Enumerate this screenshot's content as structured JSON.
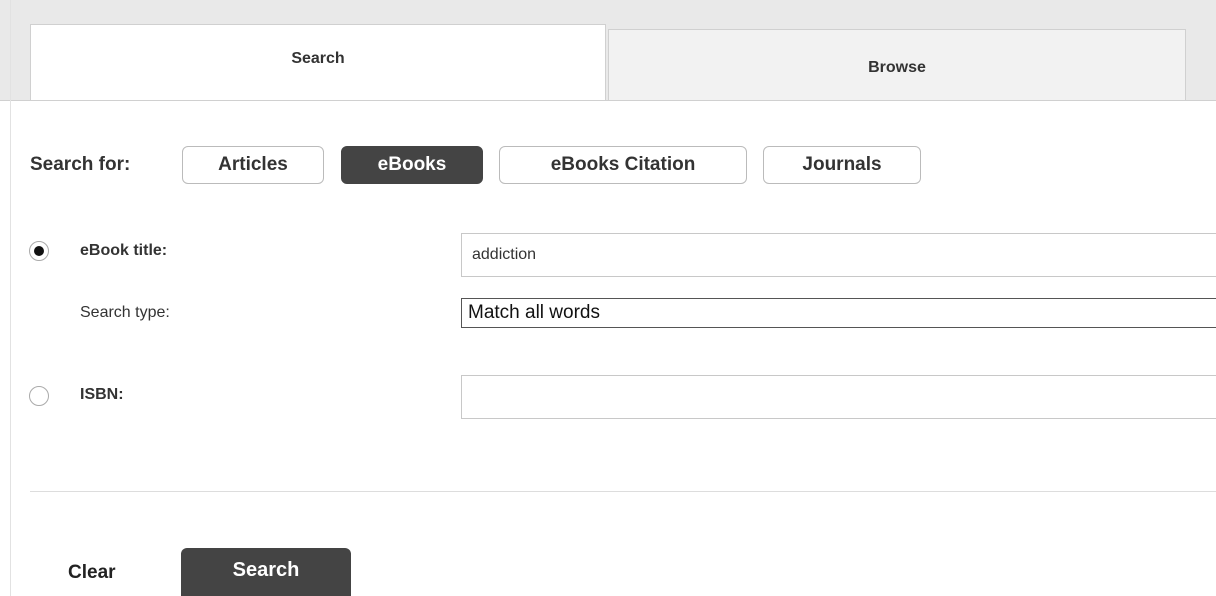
{
  "tabs": {
    "search_label": "Search",
    "browse_label": "Browse"
  },
  "search_for": {
    "label": "Search for:",
    "options": [
      "Articles",
      "eBooks",
      "eBooks Citation",
      "Journals"
    ],
    "selected": "eBooks"
  },
  "form": {
    "ebook_title_label": "eBook title:",
    "ebook_title_value": "addiction",
    "search_type_label": "Search type:",
    "search_type_value": "Match all words",
    "isbn_label": "ISBN:",
    "isbn_value": ""
  },
  "actions": {
    "clear_label": "Clear",
    "search_label": "Search"
  }
}
